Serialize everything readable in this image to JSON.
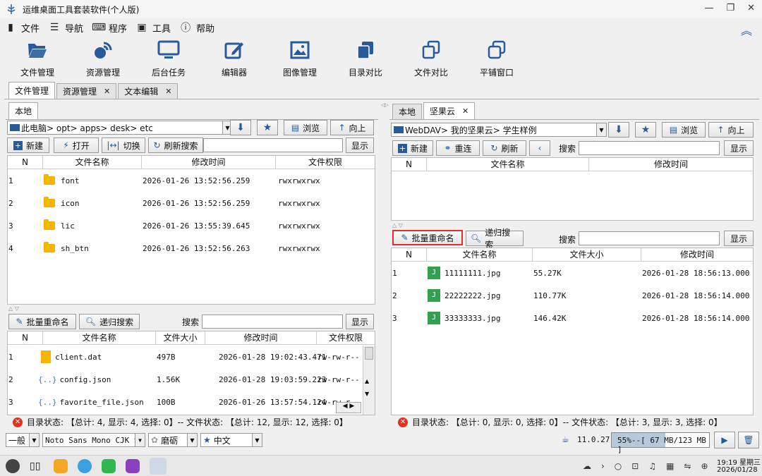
{
  "window": {
    "title": "运维桌面工具套装软件(个人版)"
  },
  "menu": [
    {
      "label": "文件",
      "icon": "file-icon"
    },
    {
      "label": "导航",
      "icon": "list-icon"
    },
    {
      "label": "程序",
      "icon": "keyboard-icon"
    },
    {
      "label": "工具",
      "icon": "toolbox-icon"
    },
    {
      "label": "帮助",
      "icon": "help-icon"
    }
  ],
  "toolbar": [
    {
      "label": "文件管理",
      "icon": "folder-open-icon"
    },
    {
      "label": "资源管理",
      "icon": "satellite-icon"
    },
    {
      "label": "后台任务",
      "icon": "monitor-icon"
    },
    {
      "label": "编辑器",
      "icon": "edit-icon"
    },
    {
      "label": "图像管理",
      "icon": "image-icon"
    },
    {
      "label": "目录对比",
      "icon": "copy-icon"
    },
    {
      "label": "文件对比",
      "icon": "clone-icon"
    },
    {
      "label": "平铺窗口",
      "icon": "windows-icon"
    }
  ],
  "main_tabs": [
    {
      "label": "文件管理",
      "closable": false
    },
    {
      "label": "资源管理",
      "closable": true
    },
    {
      "label": "文本编辑",
      "closable": true
    }
  ],
  "left": {
    "tab": "本地",
    "path": "此电脑> opt> apps> desk> etc",
    "browse_label": "浏览",
    "up_label": "向上",
    "new_label": "新建",
    "open_label": "打开",
    "switch_label": "切换",
    "refresh_search_label": "刷新搜索",
    "show_label": "显示",
    "columns": [
      "N",
      "文件名称",
      "修改时间",
      "文件权限"
    ],
    "rows": [
      {
        "n": "1",
        "name": "font",
        "time": "2026-01-26 13:52:56.259",
        "perm": "rwxrwxrwx"
      },
      {
        "n": "2",
        "name": "icon",
        "time": "2026-01-26 13:52:56.259",
        "perm": "rwxrwxrwx"
      },
      {
        "n": "3",
        "name": "lic",
        "time": "2026-01-26 13:55:39.645",
        "perm": "rwxrwxrwx"
      },
      {
        "n": "4",
        "name": "sh_btn",
        "time": "2026-01-26 13:52:56.263",
        "perm": "rwxrwxrwx"
      }
    ],
    "batch_rename": "批量重命名",
    "recursive_search": "递归搜索",
    "search_label": "搜索",
    "show2_label": "显示",
    "columns2": [
      "N",
      "文件名称",
      "文件大小",
      "修改时间",
      "文件权限"
    ],
    "rows2": [
      {
        "n": "1",
        "name": "client.dat",
        "size": "497B",
        "time": "2026-01-28 19:02:43.471",
        "perm": "rw-rw-r--"
      },
      {
        "n": "2",
        "name": "config.json",
        "size": "1.56K",
        "time": "2026-01-28 19:03:59.223",
        "perm": "rw-rw-r--"
      },
      {
        "n": "3",
        "name": "favorite_file.json",
        "size": "100B",
        "time": "2026-01-26 13:57:54.124",
        "perm": "rw-rw-r--"
      }
    ],
    "status": "目录状态: 【总计: 4, 显示: 4, 选择: 0】-- 文件状态: 【总计: 12, 显示: 12, 选择: 0】"
  },
  "right": {
    "tabs": [
      {
        "label": "本地"
      },
      {
        "label": "坚果云"
      }
    ],
    "path": "WebDAV> 我的坚果云> 学生样例",
    "browse_label": "浏览",
    "up_label": "向上",
    "new_label": "新建",
    "reconnect_label": "重连",
    "refresh_label": "刷新",
    "search_label": "搜索",
    "show_label": "显示",
    "columns": [
      "N",
      "文件名称",
      "修改时间"
    ],
    "batch_rename": "批量重命名",
    "recursive_search": "递归搜索",
    "search2_label": "搜索",
    "show2_label": "显示",
    "columns2": [
      "N",
      "文件名称",
      "文件大小",
      "修改时间"
    ],
    "rows2": [
      {
        "n": "1",
        "name": "11111111.jpg",
        "size": "55.27K",
        "time": "2026-01-28 18:56:13.000"
      },
      {
        "n": "2",
        "name": "22222222.jpg",
        "size": "110.77K",
        "time": "2026-01-28 18:56:14.000"
      },
      {
        "n": "3",
        "name": "33333333.jpg",
        "size": "146.42K",
        "time": "2026-01-28 18:56:14.000"
      }
    ],
    "status": "目录状态: 【总计: 0, 显示: 0, 选择: 0】-- 文件状态: 【总计: 3, 显示: 3, 选择: 0】"
  },
  "bottom": {
    "combo1": "一般",
    "combo2": "Noto Sans Mono CJK SC",
    "combo3": "磨砺",
    "combo4": "中文",
    "version": "11.0.27",
    "memory": "55%--[ 67 MB/123 MB ]",
    "memory_fraction": 0.55
  },
  "taskbar": {
    "time": "19:19 星期三",
    "date": "2026/01/28"
  },
  "colors": {
    "folder": "#f5b400",
    "highlight": "#e03030",
    "accent": "#2a5a9a"
  }
}
